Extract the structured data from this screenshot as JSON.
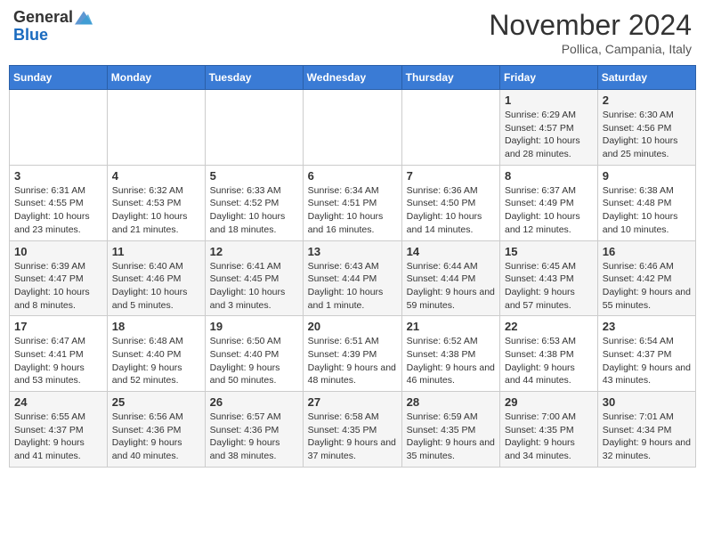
{
  "header": {
    "logo_general": "General",
    "logo_blue": "Blue",
    "month": "November 2024",
    "location": "Pollica, Campania, Italy"
  },
  "days_of_week": [
    "Sunday",
    "Monday",
    "Tuesday",
    "Wednesday",
    "Thursday",
    "Friday",
    "Saturday"
  ],
  "weeks": [
    [
      {
        "day": "",
        "info": ""
      },
      {
        "day": "",
        "info": ""
      },
      {
        "day": "",
        "info": ""
      },
      {
        "day": "",
        "info": ""
      },
      {
        "day": "",
        "info": ""
      },
      {
        "day": "1",
        "info": "Sunrise: 6:29 AM\nSunset: 4:57 PM\nDaylight: 10 hours and 28 minutes."
      },
      {
        "day": "2",
        "info": "Sunrise: 6:30 AM\nSunset: 4:56 PM\nDaylight: 10 hours and 25 minutes."
      }
    ],
    [
      {
        "day": "3",
        "info": "Sunrise: 6:31 AM\nSunset: 4:55 PM\nDaylight: 10 hours and 23 minutes."
      },
      {
        "day": "4",
        "info": "Sunrise: 6:32 AM\nSunset: 4:53 PM\nDaylight: 10 hours and 21 minutes."
      },
      {
        "day": "5",
        "info": "Sunrise: 6:33 AM\nSunset: 4:52 PM\nDaylight: 10 hours and 18 minutes."
      },
      {
        "day": "6",
        "info": "Sunrise: 6:34 AM\nSunset: 4:51 PM\nDaylight: 10 hours and 16 minutes."
      },
      {
        "day": "7",
        "info": "Sunrise: 6:36 AM\nSunset: 4:50 PM\nDaylight: 10 hours and 14 minutes."
      },
      {
        "day": "8",
        "info": "Sunrise: 6:37 AM\nSunset: 4:49 PM\nDaylight: 10 hours and 12 minutes."
      },
      {
        "day": "9",
        "info": "Sunrise: 6:38 AM\nSunset: 4:48 PM\nDaylight: 10 hours and 10 minutes."
      }
    ],
    [
      {
        "day": "10",
        "info": "Sunrise: 6:39 AM\nSunset: 4:47 PM\nDaylight: 10 hours and 8 minutes."
      },
      {
        "day": "11",
        "info": "Sunrise: 6:40 AM\nSunset: 4:46 PM\nDaylight: 10 hours and 5 minutes."
      },
      {
        "day": "12",
        "info": "Sunrise: 6:41 AM\nSunset: 4:45 PM\nDaylight: 10 hours and 3 minutes."
      },
      {
        "day": "13",
        "info": "Sunrise: 6:43 AM\nSunset: 4:44 PM\nDaylight: 10 hours and 1 minute."
      },
      {
        "day": "14",
        "info": "Sunrise: 6:44 AM\nSunset: 4:44 PM\nDaylight: 9 hours and 59 minutes."
      },
      {
        "day": "15",
        "info": "Sunrise: 6:45 AM\nSunset: 4:43 PM\nDaylight: 9 hours and 57 minutes."
      },
      {
        "day": "16",
        "info": "Sunrise: 6:46 AM\nSunset: 4:42 PM\nDaylight: 9 hours and 55 minutes."
      }
    ],
    [
      {
        "day": "17",
        "info": "Sunrise: 6:47 AM\nSunset: 4:41 PM\nDaylight: 9 hours and 53 minutes."
      },
      {
        "day": "18",
        "info": "Sunrise: 6:48 AM\nSunset: 4:40 PM\nDaylight: 9 hours and 52 minutes."
      },
      {
        "day": "19",
        "info": "Sunrise: 6:50 AM\nSunset: 4:40 PM\nDaylight: 9 hours and 50 minutes."
      },
      {
        "day": "20",
        "info": "Sunrise: 6:51 AM\nSunset: 4:39 PM\nDaylight: 9 hours and 48 minutes."
      },
      {
        "day": "21",
        "info": "Sunrise: 6:52 AM\nSunset: 4:38 PM\nDaylight: 9 hours and 46 minutes."
      },
      {
        "day": "22",
        "info": "Sunrise: 6:53 AM\nSunset: 4:38 PM\nDaylight: 9 hours and 44 minutes."
      },
      {
        "day": "23",
        "info": "Sunrise: 6:54 AM\nSunset: 4:37 PM\nDaylight: 9 hours and 43 minutes."
      }
    ],
    [
      {
        "day": "24",
        "info": "Sunrise: 6:55 AM\nSunset: 4:37 PM\nDaylight: 9 hours and 41 minutes."
      },
      {
        "day": "25",
        "info": "Sunrise: 6:56 AM\nSunset: 4:36 PM\nDaylight: 9 hours and 40 minutes."
      },
      {
        "day": "26",
        "info": "Sunrise: 6:57 AM\nSunset: 4:36 PM\nDaylight: 9 hours and 38 minutes."
      },
      {
        "day": "27",
        "info": "Sunrise: 6:58 AM\nSunset: 4:35 PM\nDaylight: 9 hours and 37 minutes."
      },
      {
        "day": "28",
        "info": "Sunrise: 6:59 AM\nSunset: 4:35 PM\nDaylight: 9 hours and 35 minutes."
      },
      {
        "day": "29",
        "info": "Sunrise: 7:00 AM\nSunset: 4:35 PM\nDaylight: 9 hours and 34 minutes."
      },
      {
        "day": "30",
        "info": "Sunrise: 7:01 AM\nSunset: 4:34 PM\nDaylight: 9 hours and 32 minutes."
      }
    ]
  ]
}
